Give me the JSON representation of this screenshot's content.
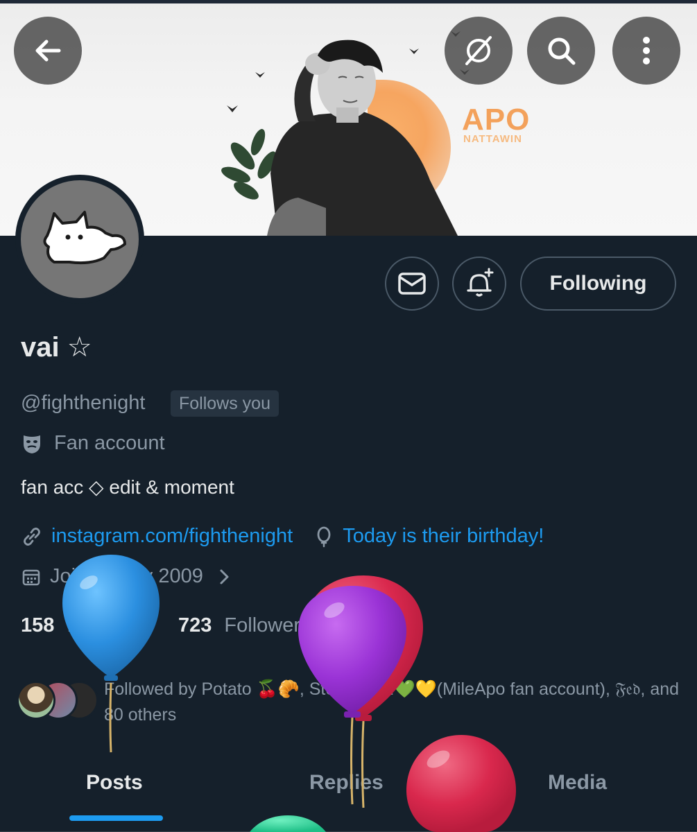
{
  "banner": {
    "title": "APO",
    "subtitle": "NATTAWIN"
  },
  "header": {
    "back_icon": "arrow-left-icon",
    "grok_icon": "grok-icon",
    "search_icon": "search-icon",
    "more_icon": "more-vertical-icon"
  },
  "actions": {
    "message_icon": "envelope-icon",
    "notify_icon": "bell-plus-icon",
    "follow_label": "Following"
  },
  "profile": {
    "name": "vai ☆",
    "handle": "@fighthenight",
    "follows_you": "Follows you",
    "category_icon": "theater-mask-icon",
    "category": "Fan account",
    "bio": "fan acc ◇ edit & moment",
    "link": "instagram.com/fighthenight",
    "birthday": "Today is their birthday!",
    "joined": "Joined May 2009"
  },
  "stats": {
    "following_count": "158",
    "following_label": "Following",
    "followers_count": "723",
    "followers_label": "Followers"
  },
  "followed_by": {
    "text": "Followed by Potato 🍒🥐, Steffy Catz💚💛(MileApo fan account), 𝔉𝔢𝔡, and 80 others"
  },
  "tabs": [
    {
      "label": "Posts"
    },
    {
      "label": "Replies"
    },
    {
      "label": "Media"
    }
  ],
  "colors": {
    "background": "#15202b",
    "accent": "#1d9bf0",
    "muted": "#8b98a5",
    "text": "#e7e9ea"
  }
}
